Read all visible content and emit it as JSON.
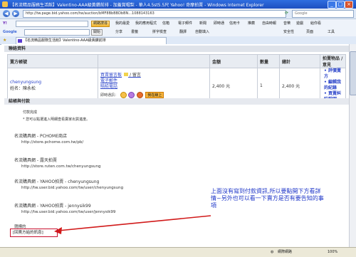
{
  "window": {
    "title": "【名流精品服務生活館】Valentino-AAA級黃鑽前排 - 加蓋賞帽梨 - 華人4.5st5.5尺 Yahoo! 奇摩拍賣 - Windows Internet Explorer",
    "controls": [
      "_",
      "□",
      "×"
    ]
  },
  "address_bar": {
    "url": "http://tw.page.bid.yahoo.com/tw/auction/bMF8BbBBDbBN...1088143163",
    "search_placeholder": "Google"
  },
  "yahoo_toolbar": {
    "logo": "Y!",
    "search_button": "網路搜尋",
    "items": [
      "我的最愛",
      "我的應用程式",
      "信箱",
      "電子郵件",
      "新聞",
      "即時通",
      "信用卡",
      "推薦",
      "自由時報",
      "音樂",
      "遊戲",
      "給你看"
    ]
  },
  "google_toolbar": {
    "logo": "Google",
    "go_button": "開始",
    "items": [
      "分享",
      "書籤",
      "拼字檢查",
      "翻譯",
      "自動填入",
      "安全性",
      "頁面",
      "工具"
    ]
  },
  "tab": {
    "label": "【名流精品服務生活館】Valentino-AAA級黃鑽前排"
  },
  "page": {
    "section1_title": "聯絡資料",
    "table": {
      "headers": [
        "賣方帳號",
        "",
        "金額",
        "數量",
        "總計",
        "拍賣物品 / 意見"
      ],
      "seller_account": "chenyungsung",
      "seller_name": "姓名：陳永松",
      "links": [
        "買賣留言板",
        "電子郵件",
        "賠給電話"
      ],
      "link_suffix": "/ 留言",
      "quick_label": "即時通訊：",
      "online_badge": "我在線上",
      "amount": "2,400 元",
      "qty": "1",
      "total": "2,400 元",
      "rules": [
        "評價賣方",
        "編輯我的紀錄",
        "買賣糾紛說明"
      ]
    },
    "section2_title": "結帳與付款",
    "payment_status": "付款完成",
    "payment_note": "* 您可以點選進入明細查看賣家出貨進度。",
    "stores": [
      {
        "name": "名流購具網 - PCHOME商店",
        "url": "http://store.pchome.com.tw/pb/"
      },
      {
        "name": "名流購具網 - 露天拍賣",
        "url": "http://store.ruten.com.tw/chenyungsung"
      },
      {
        "name": "名流購具網 - YAHOO拍賣 - chenyungsung",
        "url": "http://tw.user.bid.yahoo.com/tw/user/chenyungsung"
      },
      {
        "name": "名流購具網 - YAHOO拍賣 - jennysik99",
        "url": "http://tw.user.bid.yahoo.com/tw/user/jennysik99"
      }
    ],
    "bottom_label": "競標的",
    "message_button": "[回賣方給的訊息]",
    "annotation": "上面沒有寫到付款資訊,所以要點開下方看詳情~另外也可以看一下賣方是否有要告知的事項"
  },
  "statusbar": {
    "left": "",
    "zone": "網際網路",
    "zoom": "100%"
  },
  "colors": {
    "link": "#2a43c9",
    "annotation_text": "#1e36c8",
    "callout": "#d11a1a"
  }
}
